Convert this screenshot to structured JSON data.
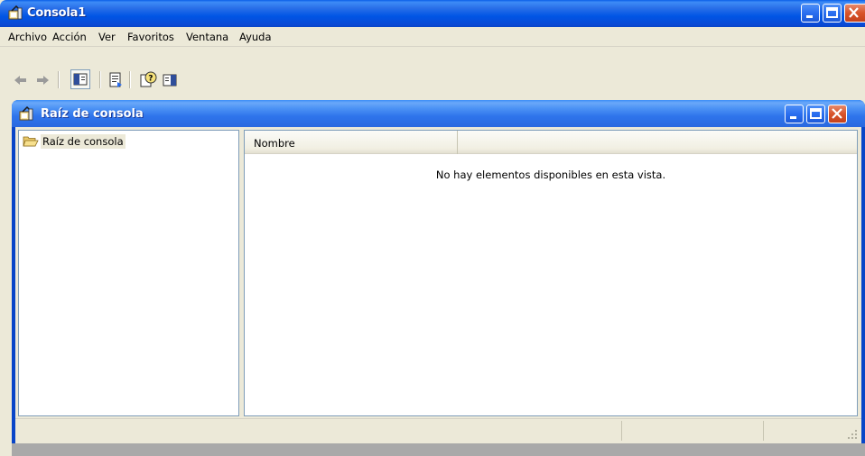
{
  "app": {
    "title": "Consola1",
    "icon": "mmc-console-icon"
  },
  "menu": {
    "items": [
      "Archivo",
      "Acción",
      "Ver",
      "Favoritos",
      "Ventana",
      "Ayuda"
    ]
  },
  "toolbar": {
    "buttons": [
      "back-arrow-icon",
      "forward-arrow-icon",
      "show-hide-tree-icon",
      "export-list-icon",
      "help-icon",
      "show-hide-action-pane-icon"
    ]
  },
  "child_window": {
    "title": "Raíz de consola"
  },
  "tree": {
    "root_label": "Raíz de consola"
  },
  "results": {
    "column_header": "Nombre",
    "empty_message": "No hay elementos disponibles en esta vista."
  },
  "colors": {
    "titlebar_blue": "#0055e5",
    "child_titlebar_blue": "#2e74ec",
    "chrome_beige": "#ece9d8",
    "close_red": "#d8532a"
  }
}
